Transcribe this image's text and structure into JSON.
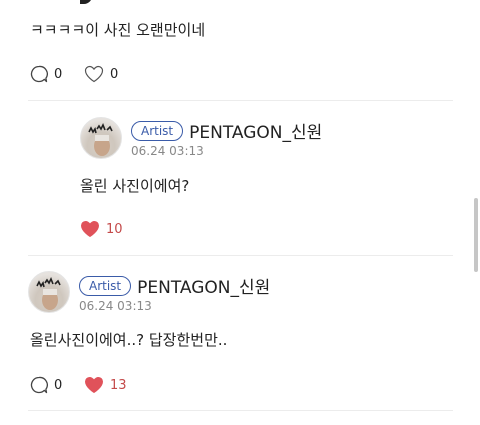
{
  "top_comment": {
    "text": "ㅋㅋㅋㅋ이 사진 오랜만이네",
    "reply_count": "0",
    "like_count": "0"
  },
  "reply": {
    "badge": "Artist",
    "author": "PENTAGON_신원",
    "time": "06.24 03:13",
    "text": "올린 사진이에여?",
    "like_count": "10"
  },
  "comment2": {
    "badge": "Artist",
    "author": "PENTAGON_신원",
    "time": "06.24 03:13",
    "text": "올린사진이에여..? 답장한번만..",
    "reply_count": "0",
    "like_count": "13"
  },
  "colors": {
    "heart_liked": "#e0525a",
    "badge_blue": "#3a5ba8"
  }
}
